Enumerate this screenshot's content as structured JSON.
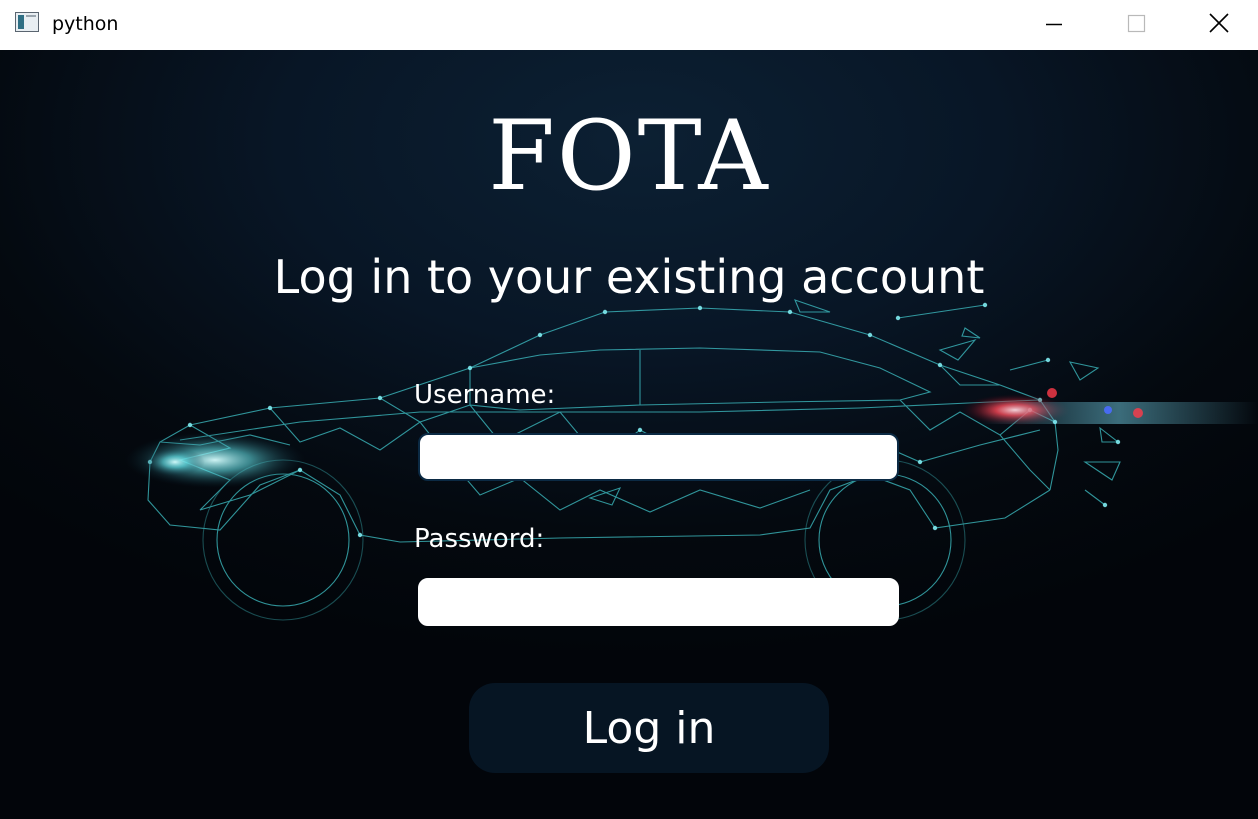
{
  "window": {
    "title": "python",
    "app_icon": "window-app-icon",
    "controls": [
      "minimize-icon",
      "maximize-icon",
      "close-icon"
    ]
  },
  "login": {
    "brand": "FOTA",
    "subtitle": "Log in to your existing account",
    "username_label": "Username:",
    "username_value": "",
    "password_label": "Password:",
    "password_value": "",
    "login_button": "Log in"
  },
  "colors": {
    "background": "#04090f",
    "text": "#ffffff",
    "wireframe": "#3fc3c8",
    "tail_light": "#ff3b4a",
    "button_bg": "#061523"
  },
  "background_image": "wireframe-car-illustration"
}
